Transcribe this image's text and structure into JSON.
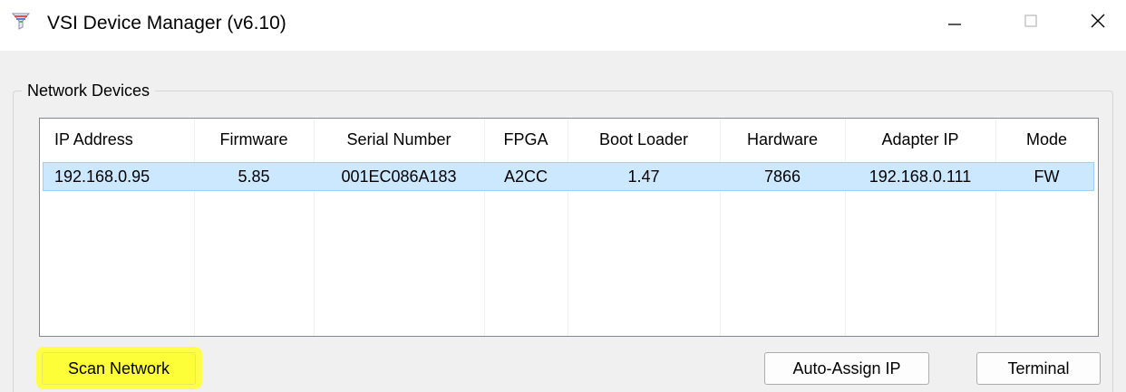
{
  "window": {
    "title": "VSI Device Manager (v6.10)",
    "icon": "funnel-app-icon",
    "controls": {
      "minimize": "minimize-icon",
      "maximize": "maximize-icon",
      "close": "close-icon"
    }
  },
  "group": {
    "label": "Network Devices"
  },
  "table": {
    "columns": [
      "IP Address",
      "Firmware",
      "Serial Number",
      "FPGA",
      "Boot Loader",
      "Hardware",
      "Adapter IP",
      "Mode"
    ],
    "rows": [
      [
        "192.168.0.95",
        "5.85",
        "001EC086A183",
        "A2CC",
        "1.47",
        "7866",
        "192.168.0.111",
        "FW"
      ]
    ],
    "selected_row": 0
  },
  "buttons": {
    "scan_label": "Scan Network",
    "auto_assign_label": "Auto-Assign IP",
    "terminal_label": "Terminal"
  },
  "colors": {
    "selection_bg": "#cce8ff",
    "selection_border": "#99d1ff",
    "highlight": "#ffff3a",
    "window_bg": "#f0f0f0"
  }
}
